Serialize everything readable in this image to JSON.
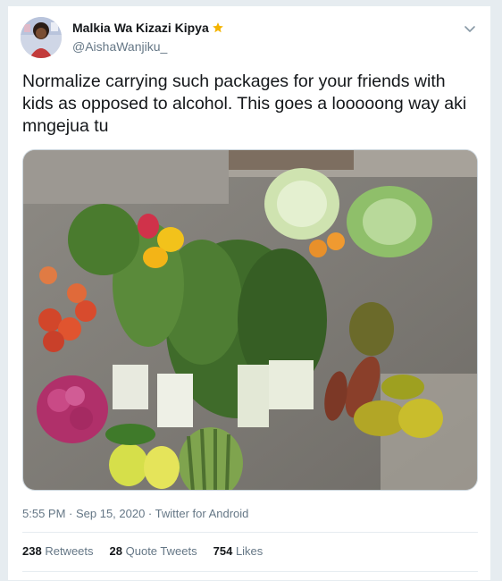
{
  "user": {
    "display_name": "Malkia Wa Kizazi Kipya",
    "handle": "@AishaWanjiku_",
    "badge_icon": "star-icon"
  },
  "tweet": {
    "text": "Normalize carrying such packages for your friends with kids as opposed to alcohol. This goes a looooong way aki mngejua tu",
    "timestamp": "5:55 PM · Sep 15, 2020 · Twitter for Android",
    "media_alt": "vegetables and fruits on the ground"
  },
  "stats": {
    "retweets_count": "238",
    "retweets_label": "Retweets",
    "quotes_count": "28",
    "quotes_label": "Quote Tweets",
    "likes_count": "754",
    "likes_label": "Likes"
  },
  "colors": {
    "primary_text": "#14171a",
    "secondary_text": "#657786",
    "border": "#e6ecf0",
    "star": "#f4b400"
  }
}
